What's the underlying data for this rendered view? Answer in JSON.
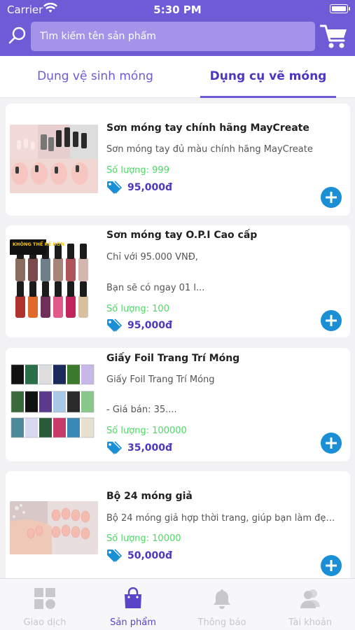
{
  "status_bar": {
    "carrier": "Carrier",
    "time": "5:30 PM"
  },
  "header": {
    "search_placeholder": "Tìm kiếm tên sản phẩm"
  },
  "tabs": [
    {
      "label": "Dụng vệ sinh móng",
      "active": false
    },
    {
      "label": "Dụng cụ vẽ móng",
      "active": true
    }
  ],
  "products": [
    {
      "name": "Sơn móng tay chính hãng MayCreate",
      "desc_line1": "Sơn móng tay đủ màu chính hãng MayCreate",
      "desc_line2": "",
      "quantity": "Số lượng: 999",
      "price": "95,000đ"
    },
    {
      "name": "Sơn móng tay O.P.I Cao cấp",
      "desc_line1": "Chỉ với 95.000 VNĐ,",
      "desc_line2": "Bạn sẽ có ngay 01 l...",
      "quantity": "Số lượng: 100",
      "price": "95,000đ"
    },
    {
      "name": "Giấy Foil Trang Trí Móng",
      "desc_line1": "Giấy Foil Trang Trí Móng",
      "desc_line2": "- Giá bán: 35....",
      "quantity": "Số lượng: 100000",
      "price": "35,000đ"
    },
    {
      "name": "Bộ 24 móng giả",
      "desc_line1": "Bộ 24 móng giả hợp thời trang, giúp bạn làm đẹp...",
      "desc_line2": "",
      "quantity": "Số lượng: 10000",
      "price": "50,000đ"
    }
  ],
  "image_text": {
    "opi_banner": "KHÔNG THỂ RẺ HƠN"
  },
  "bottom_nav": [
    {
      "label": "Giao dịch",
      "icon": "dashboard-icon",
      "active": false
    },
    {
      "label": "Sản phẩm",
      "icon": "shopping-bag-icon",
      "active": true
    },
    {
      "label": "Thông báo",
      "icon": "bell-icon",
      "active": false
    },
    {
      "label": "Tài khoản",
      "icon": "users-icon",
      "active": false
    }
  ],
  "colors": {
    "brand": "#6f5bd6",
    "accent": "#4c37c2",
    "quantity": "#4cd964",
    "add_button": "#1a8fd6"
  }
}
